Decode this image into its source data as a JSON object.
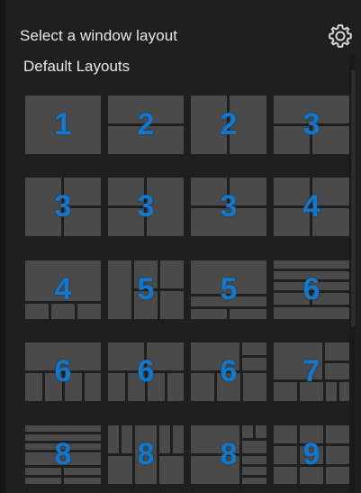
{
  "header": {
    "title": "Select a window layout",
    "settings_icon": "gear-icon"
  },
  "section": {
    "label": "Default Layouts"
  },
  "colors": {
    "background": "#1f1f1f",
    "tile": "#4a4a4a",
    "divider": "#1f1f1f",
    "number": "#1677c8",
    "text": "#e8e8e8"
  },
  "layouts": [
    {
      "number": "1"
    },
    {
      "number": "2"
    },
    {
      "number": "2"
    },
    {
      "number": "3"
    },
    {
      "number": "3"
    },
    {
      "number": "3"
    },
    {
      "number": "3"
    },
    {
      "number": "4"
    },
    {
      "number": "4"
    },
    {
      "number": "5"
    },
    {
      "number": "5"
    },
    {
      "number": "6"
    },
    {
      "number": "6"
    },
    {
      "number": "6"
    },
    {
      "number": "6"
    },
    {
      "number": "7"
    },
    {
      "number": "8"
    },
    {
      "number": "8"
    },
    {
      "number": "8"
    },
    {
      "number": "9"
    }
  ]
}
